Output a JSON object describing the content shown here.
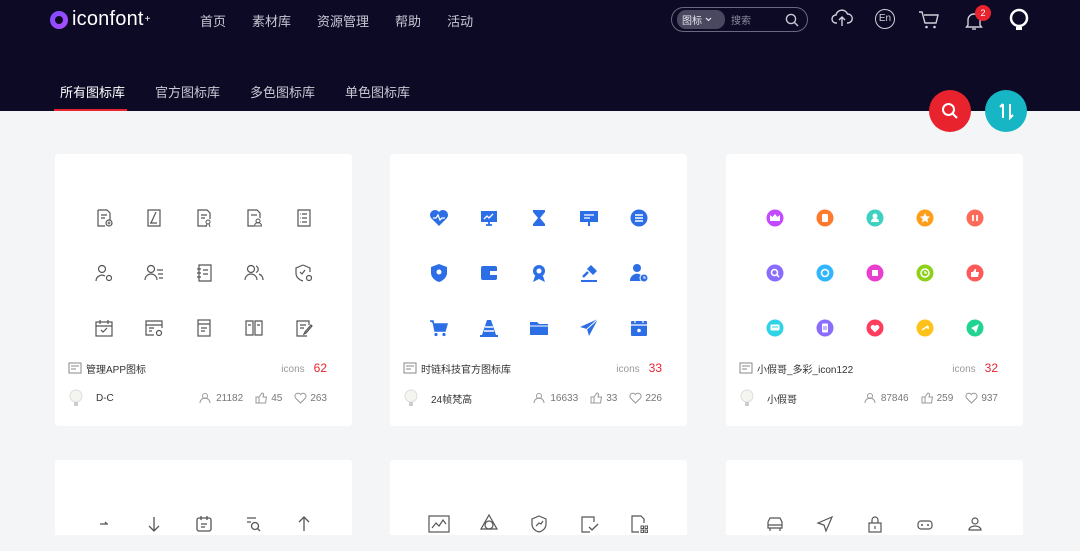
{
  "brand": {
    "name": "iconfont",
    "plus": "+"
  },
  "nav": [
    "首页",
    "素材库",
    "资源管理",
    "帮助",
    "活动"
  ],
  "search": {
    "type": "图标",
    "placeholder": "搜索"
  },
  "lang_label": "En",
  "notifications": "2",
  "tabs": [
    "所有图标库",
    "官方图标库",
    "多色图标库",
    "单色图标库"
  ],
  "colors": {
    "header": "#0c0a25",
    "accent_red": "#e8232d",
    "teal": "#17b6c4",
    "blue": "#2c6ee6"
  },
  "cards": [
    {
      "title": "管理APP图标",
      "icons_label": "icons",
      "count": "62",
      "author": "D-C",
      "users": "21182",
      "likes": "45",
      "favs": "263"
    },
    {
      "title": "时链科技官方图标库",
      "icons_label": "icons",
      "count": "33",
      "author": "24帧梵高",
      "users": "16633",
      "likes": "33",
      "favs": "226"
    },
    {
      "title": "小假哥_多彩_icon122",
      "icons_label": "icons",
      "count": "32",
      "author": "小假哥",
      "users": "87846",
      "likes": "259",
      "favs": "937"
    }
  ]
}
